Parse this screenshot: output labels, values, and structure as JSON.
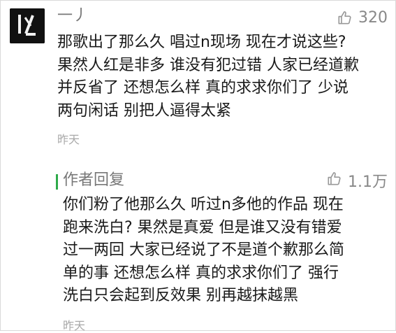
{
  "comment": {
    "username": "一丿",
    "likes": "320",
    "text_lines": [
      "那歌出了那么久  唱过n现场  现在才说这些?",
      "果然人红是非多  谁没有犯过错  人家已经道歉",
      "并反省了  还想怎么样  真的求求你们了  少说",
      "两句闲话  别把人逼得太紧"
    ],
    "timestamp": "昨天"
  },
  "reply": {
    "label": "作者回复",
    "likes": "1.1万",
    "text_lines": [
      "你们粉了他那么久   听过n多他的作品  现在",
      "跑来洗白? 果然是真爱  但是谁又没有错爱",
      "过一两回  大家已经说了不是道个歉那么简",
      "单的事  还想怎么样  真的求求你们了   强行",
      "洗白只会起到反效果  别再越抹越黑"
    ],
    "timestamp": "昨天"
  },
  "colors": {
    "accent_green": "#2eaa4a",
    "meta_gray": "#888888",
    "timestamp_gray": "#a9a9a9"
  },
  "icons": {
    "like": "thumbs-up-outline-icon",
    "avatar": "user-avatar"
  }
}
